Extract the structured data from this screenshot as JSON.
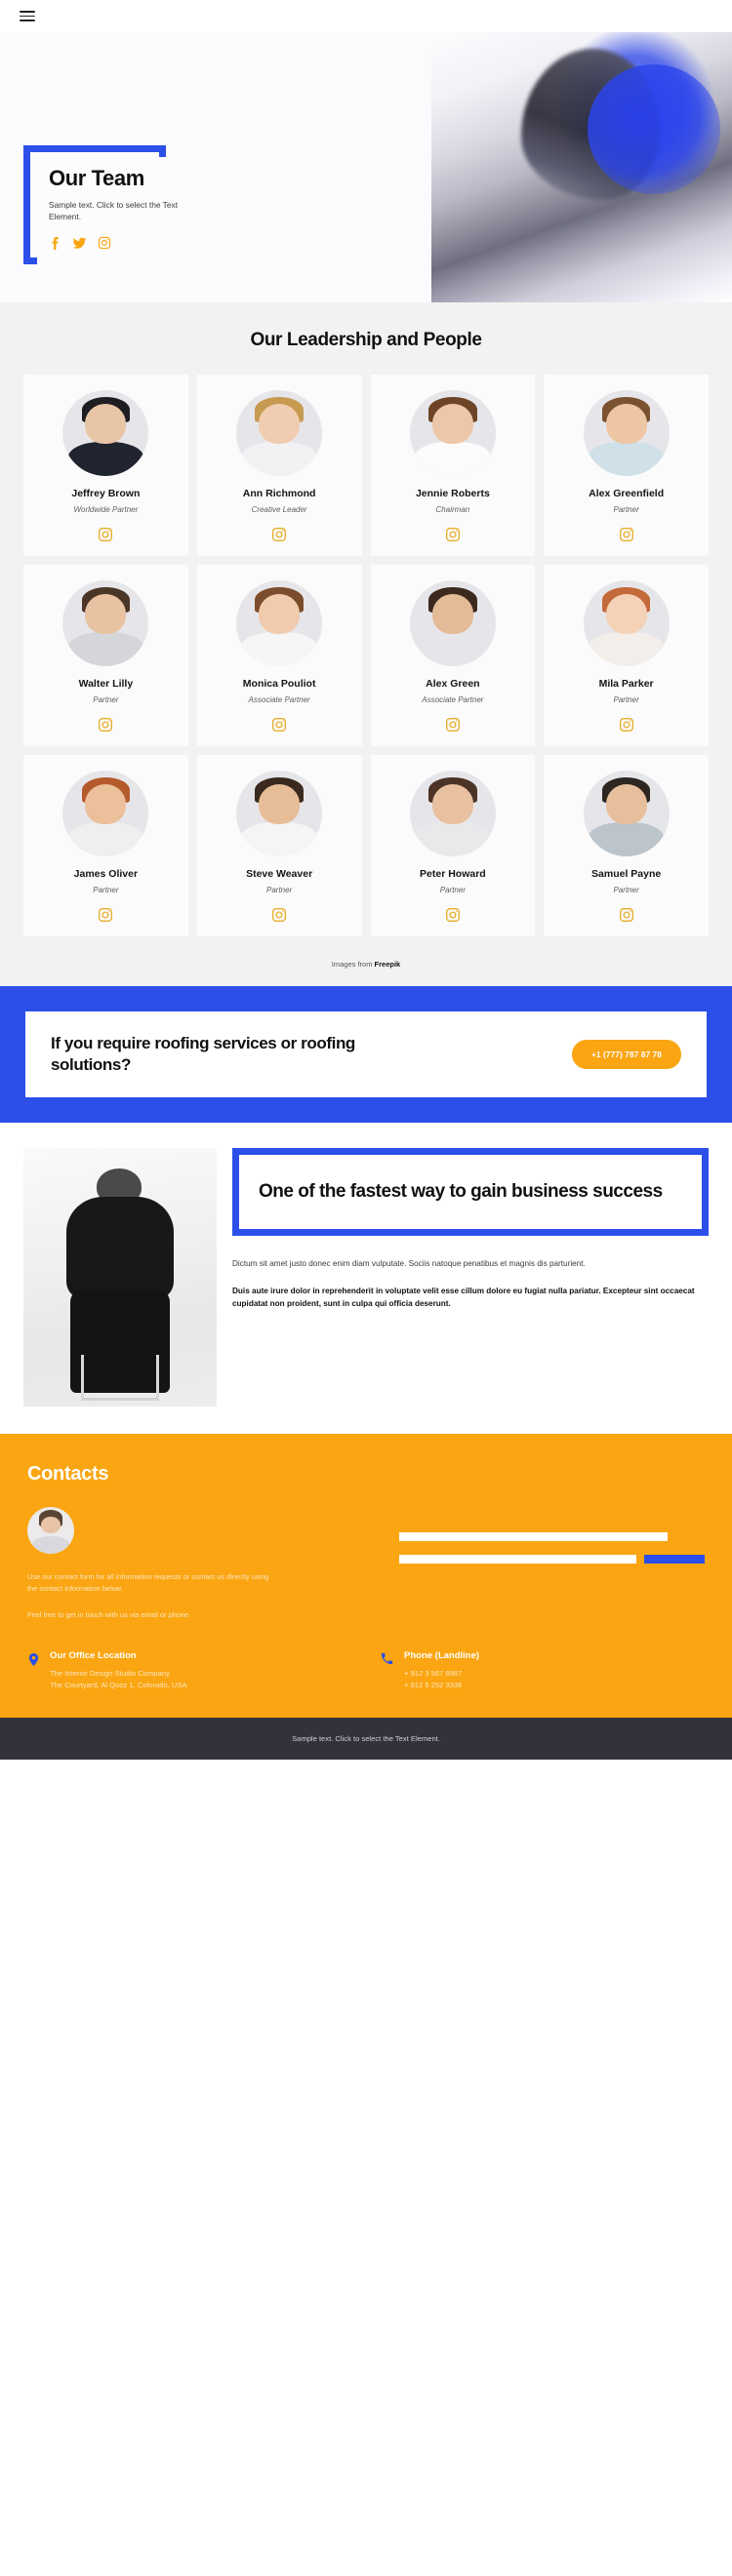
{
  "colors": {
    "brand_blue": "#2B4FE8",
    "brand_amber": "#FAA511",
    "team_bg": "#f2f2f2",
    "footer_bg": "#32323c"
  },
  "topbar": {
    "menu_icon": "hamburger-menu-icon"
  },
  "hero": {
    "title": "Our Team",
    "subtitle": "Sample text. Click to select the Text Element.",
    "socials": [
      {
        "name": "facebook-icon",
        "label": "Facebook"
      },
      {
        "name": "twitter-icon",
        "label": "Twitter"
      },
      {
        "name": "instagram-icon",
        "label": "Instagram"
      }
    ]
  },
  "team": {
    "heading": "Our Leadership and People",
    "credits_prefix": "Images from ",
    "credits_link": "Freepik",
    "members": [
      {
        "name": "Jeffrey Brown",
        "role": "Worldwide Partner",
        "social": "instagram-icon",
        "hair": "#1d1d22",
        "skin": "#e8c5a6",
        "body": "#20242e"
      },
      {
        "name": "Ann Richmond",
        "role": "Creative Leader",
        "social": "instagram-icon",
        "hair": "#c79a52",
        "skin": "#f0cdb0",
        "body": "#f2f2f4"
      },
      {
        "name": "Jennie Roberts",
        "role": "Chairman",
        "social": "instagram-icon",
        "hair": "#6d4526",
        "skin": "#eec7a9",
        "body": "#fbfbfc"
      },
      {
        "name": "Alex Greenfield",
        "role": "Partner",
        "social": "instagram-icon",
        "hair": "#7a5230",
        "skin": "#eec6a4",
        "body": "#cfe0e8"
      },
      {
        "name": "Walter Lilly",
        "role": "Partner",
        "social": "instagram-icon",
        "hair": "#4a3526",
        "skin": "#e9c2a1",
        "body": "#d5d6da"
      },
      {
        "name": "Monica Pouliot",
        "role": "Associate Partner",
        "social": "instagram-icon",
        "hair": "#7c4d2c",
        "skin": "#f0cbae",
        "body": "#f6f6f7"
      },
      {
        "name": "Alex Green",
        "role": "Associate Partner",
        "social": "instagram-icon",
        "hair": "#3b2a1d",
        "skin": "#e4bb97",
        "body": "#e6e6ea"
      },
      {
        "name": "Mila Parker",
        "role": "Partner",
        "social": "instagram-icon",
        "hair": "#c4693a",
        "skin": "#f3d2b7",
        "body": "#f3eee9"
      },
      {
        "name": "James Oliver",
        "role": "Partner",
        "social": "instagram-icon",
        "hair": "#b55a2c",
        "skin": "#ebc09b",
        "body": "#efefef"
      },
      {
        "name": "Steve Weaver",
        "role": "Partner",
        "social": "instagram-icon",
        "hair": "#3a2a1e",
        "skin": "#e7bd98",
        "body": "#f5f5f5"
      },
      {
        "name": "Peter Howard",
        "role": "Partner",
        "social": "instagram-icon",
        "hair": "#4b3425",
        "skin": "#e9c1a0",
        "body": "#e9e9ec"
      },
      {
        "name": "Samuel Payne",
        "role": "Partner",
        "social": "instagram-icon",
        "hair": "#2e2620",
        "skin": "#e7bf9d",
        "body": "#bcc4cc"
      }
    ]
  },
  "cta": {
    "text": "If you require roofing services or roofing solutions?",
    "button_label": "+1 (777) 787 87 78"
  },
  "success": {
    "heading": "One of the fastest way to gain business success",
    "paragraph": "Dictum sit amet justo donec enim diam vulputate. Sociis natoque penatibus et magnis dis parturient.",
    "paragraph_bold": "Duis aute irure dolor in reprehenderit in voluptate velit esse cillum dolore eu fugiat nulla pariatur. Excepteur sint occaecat cupidatat non proident, sunt in culpa qui officia deserunt."
  },
  "contacts": {
    "title": "Contacts",
    "avatar": "contact-person-avatar",
    "intro": "Use our contact form for all information requests or contact us directly using the contact information below.",
    "intro_second": "Feel free to get in touch with us via email or phone",
    "form": {
      "field_one_placeholder": "",
      "field_two_placeholder": "",
      "submit_label": ""
    },
    "blocks": [
      {
        "icon": "location-pin-icon",
        "title": "Our Office Location",
        "line1": "The Interior Design Studio Company",
        "line2": "The Courtyard, Al Quoz 1, Colorado,  USA"
      },
      {
        "icon": "phone-icon",
        "title": "Phone (Landline)",
        "line1": "+ 912 3 567 8987",
        "line2": "+ 912 5 252 3336"
      }
    ]
  },
  "footer": {
    "text": "Sample text. Click to select the Text Element."
  }
}
